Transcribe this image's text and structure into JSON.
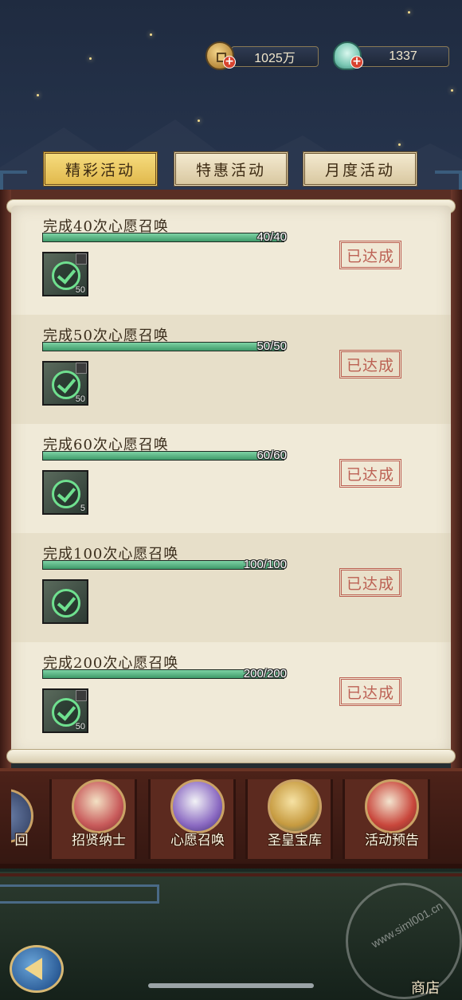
{
  "currency": {
    "coins": "1025万",
    "shells": "1337"
  },
  "tabs": [
    {
      "label": "精彩活动",
      "active": true
    },
    {
      "label": "特惠活动",
      "active": false
    },
    {
      "label": "月度活动",
      "active": false
    }
  ],
  "quests": [
    {
      "title": "完成40次心愿召唤",
      "progress": "40/40",
      "fraction": 1.0,
      "reward_qty": "50",
      "status": "已达成"
    },
    {
      "title": "完成50次心愿召唤",
      "progress": "50/50",
      "fraction": 1.0,
      "reward_qty": "50",
      "status": "已达成"
    },
    {
      "title": "完成60次心愿召唤",
      "progress": "60/60",
      "fraction": 1.0,
      "reward_qty": "5",
      "status": "已达成"
    },
    {
      "title": "完成100次心愿召唤",
      "progress": "100/100",
      "fraction": 1.0,
      "reward_qty": "",
      "status": "已达成"
    },
    {
      "title": "完成200次心愿召唤",
      "progress": "200/200",
      "fraction": 1.0,
      "reward_qty": "50",
      "status": "已达成"
    }
  ],
  "bottom_nav": [
    {
      "label": "招贤纳士",
      "icon": "scroll-icon"
    },
    {
      "label": "心愿召唤",
      "icon": "wish-scroll-icon"
    },
    {
      "label": "圣皇宝库",
      "icon": "golden-key-icon"
    },
    {
      "label": "活动预告",
      "icon": "drum-icon"
    }
  ],
  "partial_nav_label": "回",
  "shop_label": "商店",
  "watermark": "www.siml001.cn",
  "colors": {
    "tab_active": "#e8c35a",
    "progress_fill": "#4fb07a",
    "stamp_red": "#b44a3e",
    "wood": "#5a2e24"
  }
}
